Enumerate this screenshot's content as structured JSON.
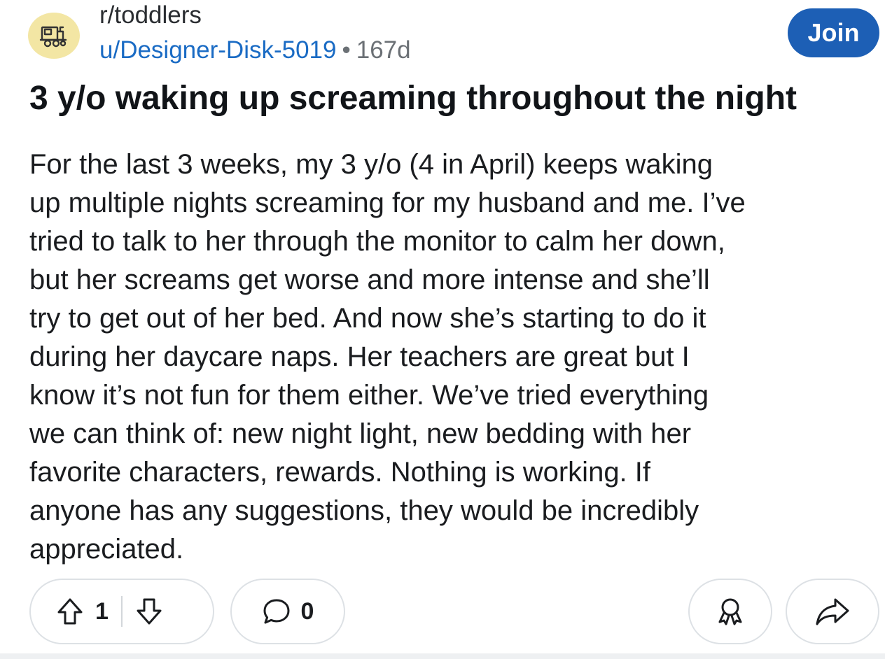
{
  "post": {
    "subreddit": "r/toddlers",
    "author": "u/Designer-Disk-5019",
    "separator": "•",
    "age": "167d",
    "join_label": "Join",
    "title": "3 y/o waking up screaming throughout the night",
    "body_lines": [
      "For the last 3 weeks, my 3 y/o (4 in April) keeps waking",
      "up multiple nights screaming for my husband and me. I’ve",
      "tried to talk to her through the monitor to calm her down,",
      "but her screams get worse and more intense and she’ll",
      "try to get out of her bed. And now she’s starting to do it",
      "during her daycare naps. Her teachers are great but I",
      "know it’s not fun for them either. We’ve tried everything",
      "we can think of: new night light, new bedding with her",
      "favorite characters, rewards. Nothing is working. If",
      "anyone has any suggestions, they would be incredibly",
      "appreciated."
    ]
  },
  "actions": {
    "vote_count": "1",
    "comment_count": "0"
  },
  "icons": {
    "avatar": "train-icon",
    "upvote": "upvote-arrow-icon",
    "downvote": "downvote-arrow-icon",
    "comment": "comment-bubble-icon",
    "award": "award-icon",
    "share": "share-arrow-icon"
  },
  "colors": {
    "accent": "#1d5fb5",
    "author_link": "#1a6bc4",
    "avatar_bg": "#f3e6a4",
    "muted": "#6b7075"
  }
}
